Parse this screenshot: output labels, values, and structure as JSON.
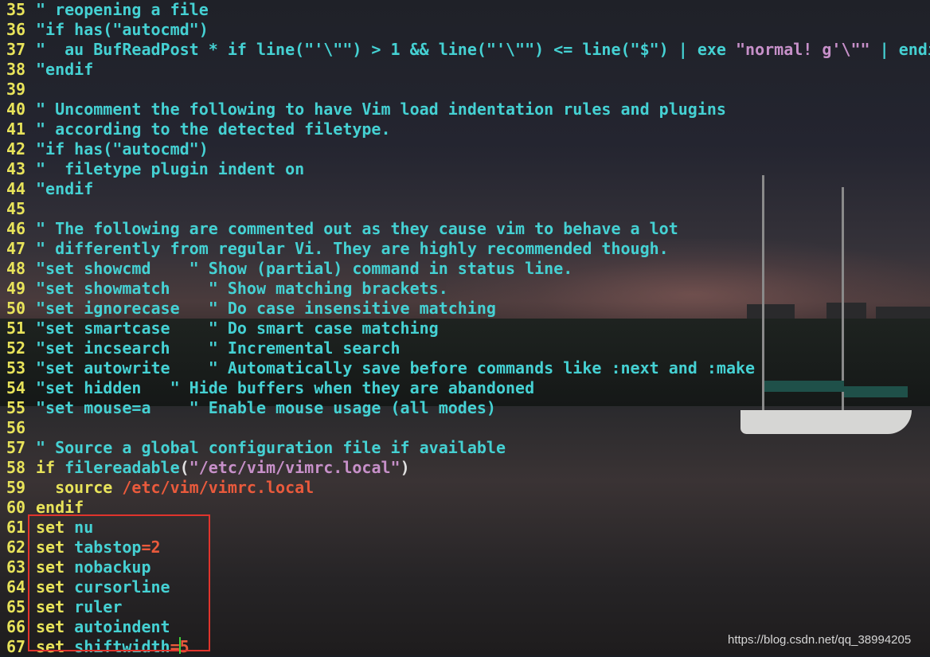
{
  "background": {
    "scene": "harbor-at-dusk-photo",
    "colors": {
      "comment": "#45d1d3",
      "linenr": "#e8e35a",
      "string": "#c790c9",
      "value": "#ea5a3c",
      "highlight_box": "#e0342c",
      "cursor": "#3fd13b"
    }
  },
  "lines": [
    {
      "n": "35",
      "segs": [
        {
          "t": "\" reopening a file",
          "c": "c"
        }
      ]
    },
    {
      "n": "36",
      "segs": [
        {
          "t": "\"if has(\"autocmd\")",
          "c": "c"
        }
      ]
    },
    {
      "n": "37",
      "segs": [
        {
          "t": "\"  au BufReadPost * if line(\"'\\\"\") > 1 && line(\"'\\\"\") <= line(\"$\") | exe ",
          "c": "c"
        },
        {
          "t": "\"normal! g'\\\"\"",
          "c": "p"
        },
        {
          "t": " | endi",
          "c": "c"
        }
      ]
    },
    {
      "n": "38",
      "segs": [
        {
          "t": "\"endif",
          "c": "c"
        }
      ]
    },
    {
      "n": "39",
      "segs": []
    },
    {
      "n": "40",
      "segs": [
        {
          "t": "\" Uncomment the following to have Vim load indentation rules and plugins",
          "c": "c"
        }
      ]
    },
    {
      "n": "41",
      "segs": [
        {
          "t": "\" according to the detected filetype.",
          "c": "c"
        }
      ]
    },
    {
      "n": "42",
      "segs": [
        {
          "t": "\"if has(\"autocmd\")",
          "c": "c"
        }
      ]
    },
    {
      "n": "43",
      "segs": [
        {
          "t": "\"  filetype plugin indent on",
          "c": "c"
        }
      ]
    },
    {
      "n": "44",
      "segs": [
        {
          "t": "\"endif",
          "c": "c"
        }
      ]
    },
    {
      "n": "45",
      "segs": []
    },
    {
      "n": "46",
      "segs": [
        {
          "t": "\" The following are commented out as they cause vim to behave a lot",
          "c": "c"
        }
      ]
    },
    {
      "n": "47",
      "segs": [
        {
          "t": "\" differently from regular Vi. They are highly recommended though.",
          "c": "c"
        }
      ]
    },
    {
      "n": "48",
      "segs": [
        {
          "t": "\"set showcmd    \" Show (partial) command in status line.",
          "c": "c"
        }
      ]
    },
    {
      "n": "49",
      "segs": [
        {
          "t": "\"set showmatch    \" Show matching brackets.",
          "c": "c"
        }
      ]
    },
    {
      "n": "50",
      "segs": [
        {
          "t": "\"set ignorecase   \" Do case insensitive matching",
          "c": "c"
        }
      ]
    },
    {
      "n": "51",
      "segs": [
        {
          "t": "\"set smartcase    \" Do smart case matching",
          "c": "c"
        }
      ]
    },
    {
      "n": "52",
      "segs": [
        {
          "t": "\"set incsearch    \" Incremental search",
          "c": "c"
        }
      ]
    },
    {
      "n": "53",
      "segs": [
        {
          "t": "\"set autowrite    \" Automatically save before commands like :next and :make",
          "c": "c"
        }
      ]
    },
    {
      "n": "54",
      "segs": [
        {
          "t": "\"set hidden   \" Hide buffers when they are abandoned",
          "c": "c"
        }
      ]
    },
    {
      "n": "55",
      "segs": [
        {
          "t": "\"set mouse=a    \" Enable mouse usage (all modes)",
          "c": "c"
        }
      ]
    },
    {
      "n": "56",
      "segs": []
    },
    {
      "n": "57",
      "segs": [
        {
          "t": "\" Source a global configuration file if available",
          "c": "c"
        }
      ]
    },
    {
      "n": "58",
      "segs": [
        {
          "t": "if ",
          "c": "y"
        },
        {
          "t": "filereadable",
          "c": "c"
        },
        {
          "t": "(",
          "c": "w"
        },
        {
          "t": "\"/etc/vim/vimrc.local\"",
          "c": "p"
        },
        {
          "t": ")",
          "c": "w"
        }
      ]
    },
    {
      "n": "59",
      "segs": [
        {
          "t": "  source ",
          "c": "y"
        },
        {
          "t": "/etc/vim/vimrc.local",
          "c": "o"
        }
      ]
    },
    {
      "n": "60",
      "segs": [
        {
          "t": "endif",
          "c": "y"
        }
      ]
    },
    {
      "n": "61",
      "segs": [
        {
          "t": "set ",
          "c": "y"
        },
        {
          "t": "nu",
          "c": "c"
        }
      ]
    },
    {
      "n": "62",
      "segs": [
        {
          "t": "set ",
          "c": "y"
        },
        {
          "t": "tabstop",
          "c": "c"
        },
        {
          "t": "=2",
          "c": "o"
        }
      ]
    },
    {
      "n": "63",
      "segs": [
        {
          "t": "set ",
          "c": "y"
        },
        {
          "t": "nobackup",
          "c": "c"
        }
      ]
    },
    {
      "n": "64",
      "segs": [
        {
          "t": "set ",
          "c": "y"
        },
        {
          "t": "cursorline",
          "c": "c"
        }
      ]
    },
    {
      "n": "65",
      "segs": [
        {
          "t": "set ",
          "c": "y"
        },
        {
          "t": "ruler",
          "c": "c"
        }
      ]
    },
    {
      "n": "66",
      "segs": [
        {
          "t": "set ",
          "c": "y"
        },
        {
          "t": "autoindent",
          "c": "c"
        }
      ]
    },
    {
      "n": "67",
      "segs": [
        {
          "t": "set ",
          "c": "y"
        },
        {
          "t": "shiftwidth",
          "c": "c"
        },
        {
          "t": "=5",
          "c": "o"
        }
      ]
    }
  ],
  "watermark": "https://blog.csdn.net/qq_38994205"
}
